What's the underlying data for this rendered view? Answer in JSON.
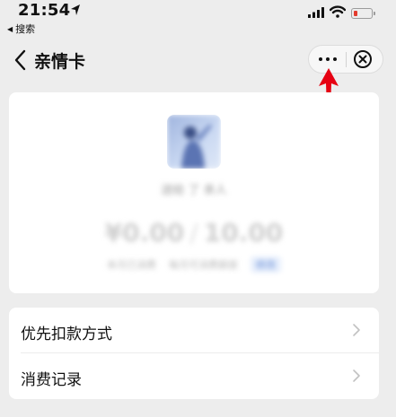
{
  "status_bar": {
    "time": "21:54",
    "back_to_app": "搜索",
    "battery_color": "#e33b2e"
  },
  "nav": {
    "title": "亲情卡",
    "more_icon": "more-dots-icon",
    "close_icon": "close-circle-icon"
  },
  "annotation": {
    "arrow_color": "#e60012"
  },
  "card": {
    "name": "送给 了 亲人",
    "limit_amount": "¥0.00",
    "limit_total": "10.00",
    "info_left": "本月已消费",
    "info_right": "每月可消费额度",
    "info_link": "修改"
  },
  "menu": {
    "items": [
      {
        "label": "优先扣款方式"
      },
      {
        "label": "消费记录"
      }
    ]
  }
}
